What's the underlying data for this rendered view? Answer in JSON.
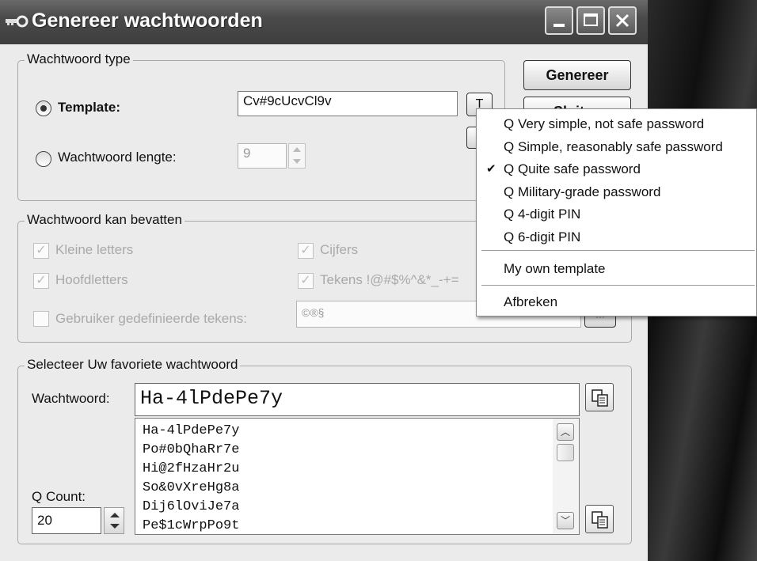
{
  "window": {
    "title": "Genereer wachtwoorden"
  },
  "password_type": {
    "legend": "Wachtwoord type",
    "template_label": "Template:",
    "template_value": "Cv#9cUcvCl9v",
    "template_button": "T",
    "length_label": "Wachtwoord lengte:",
    "length_value": "9"
  },
  "buttons": {
    "generate": "Genereer",
    "close_partial": "Sluiten"
  },
  "can_contain": {
    "legend": "Wachtwoord kan bevatten",
    "lowercase": "Kleine letters",
    "digits": "Cijfers",
    "uppercase": "Hoofdletters",
    "symbols": "Tekens !@#$%^&*_-+=",
    "custom_label": "Gebruiker gedefinieerde tekens:",
    "custom_value": "©®§",
    "custom_button": "..."
  },
  "favorite": {
    "legend": "Selecteer Uw favoriete wachtwoord",
    "password_label": "Wachtwoord:",
    "password_value": "Ha-4lPdePe7y",
    "count_label": "Q Count:",
    "count_value": "20",
    "list": [
      "Ha-4lPdePe7y",
      "Po#0bQhaRr7e",
      "Hi@2fHzaHr2u",
      "So&0vXreHg8a",
      "Dij6lOviJe7a",
      "Pe$1cWrpPo9t"
    ]
  },
  "menu": {
    "items": [
      {
        "label": "Q Very simple, not safe password",
        "checked": false
      },
      {
        "label": "Q Simple, reasonably safe password",
        "checked": false
      },
      {
        "label": "Q Quite safe password",
        "checked": true
      },
      {
        "label": "Q Military-grade password",
        "checked": false
      },
      {
        "label": "Q 4-digit PIN",
        "checked": false
      },
      {
        "label": "Q 6-digit PIN",
        "checked": false
      }
    ],
    "own_template": "My own template",
    "cancel": "Afbreken"
  }
}
